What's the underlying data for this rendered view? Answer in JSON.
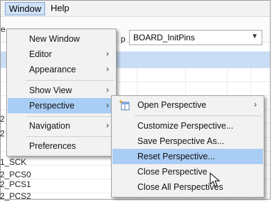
{
  "menubar": {
    "window": "Window",
    "help": "Help"
  },
  "toolbar": {
    "cropped_left": "e",
    "cropped_p": "p",
    "combo_value": "BOARD_InitPins"
  },
  "row_labels": [
    "2",
    "2",
    "1_SCK",
    "2_PCS0",
    "2_PCS1",
    "2_PCS2"
  ],
  "window_menu": {
    "items": [
      {
        "label": "New Window",
        "submenu": false
      },
      {
        "label": "Editor",
        "submenu": true
      },
      {
        "label": "Appearance",
        "submenu": true
      },
      {
        "label": "Show View",
        "submenu": true
      },
      {
        "label": "Perspective",
        "submenu": true,
        "selected": true
      },
      {
        "label": "Navigation",
        "submenu": true
      },
      {
        "label": "Preferences",
        "submenu": false
      }
    ]
  },
  "perspective_menu": {
    "items": [
      {
        "label": "Open Perspective",
        "submenu": true,
        "icon": "open-perspective-icon"
      },
      {
        "label": "Customize Perspective...",
        "submenu": false
      },
      {
        "label": "Save Perspective As...",
        "submenu": false
      },
      {
        "label": "Reset Perspective...",
        "submenu": false,
        "selected": true
      },
      {
        "label": "Close Perspective",
        "submenu": false
      },
      {
        "label": "Close All Perspectives",
        "submenu": false
      }
    ]
  },
  "colors": {
    "selection": "#a9cdf4",
    "menu_bg": "#f2f2f2",
    "header_band": "#c9def6"
  }
}
